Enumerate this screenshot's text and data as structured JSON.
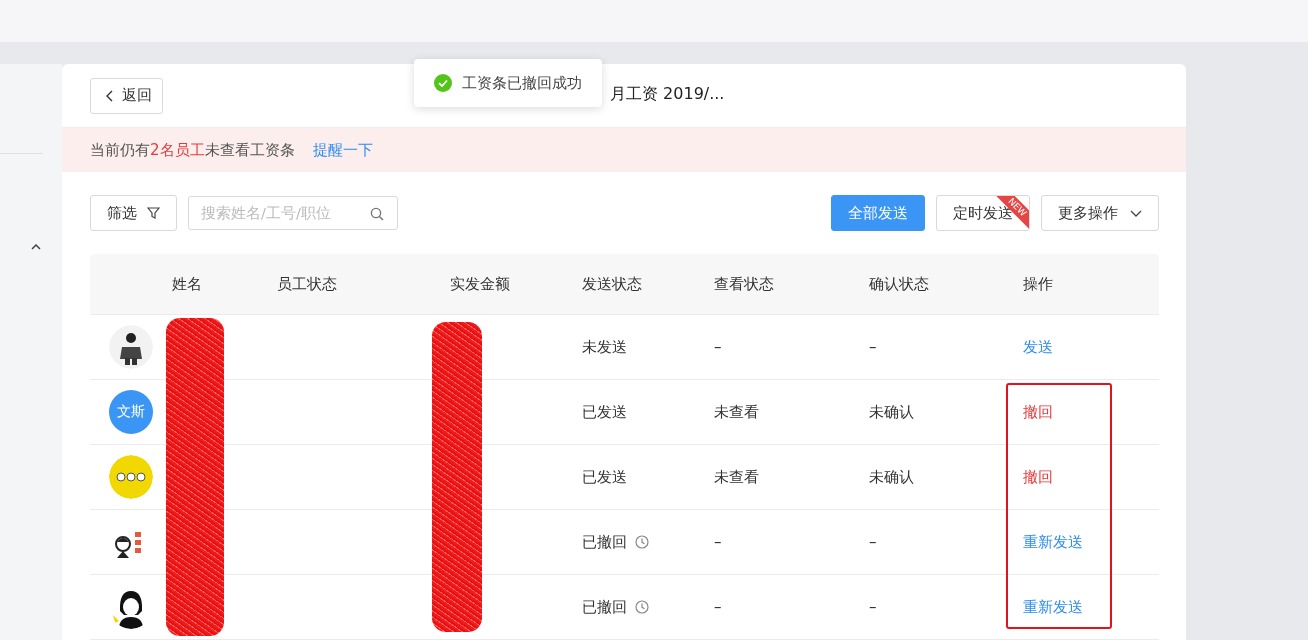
{
  "header": {
    "back_button": "返回",
    "title": "月工资 2019/..."
  },
  "toast": {
    "message": "工资条已撤回成功"
  },
  "alert": {
    "parts": [
      "当前仍有",
      "2名员工",
      "未查看工资条"
    ],
    "link": "提醒一下"
  },
  "toolbar": {
    "filter_button": "筛选",
    "search": {
      "placeholder": "搜索姓名/工号/职位"
    },
    "send_all_button": "全部发送",
    "schedule_button": "定时发送",
    "schedule_badge": "NEW",
    "more_button": "更多操作"
  },
  "table": {
    "columns": [
      "姓名",
      "员工状态",
      "实发金额",
      "发送状态",
      "查看状态",
      "确认状态",
      "操作"
    ],
    "rows": [
      {
        "send_status": "未发送",
        "recalled": false,
        "view_status": "–",
        "confirm_status": "–",
        "action": {
          "kind": "send",
          "label": "发送"
        }
      },
      {
        "avatar": {
          "kind": "text",
          "text": "文斯",
          "color": "#3a95f5"
        },
        "send_status": "已发送",
        "recalled": false,
        "view_status": "未查看",
        "confirm_status": "未确认",
        "action": {
          "kind": "revoke",
          "label": "撤回"
        }
      },
      {
        "send_status": "已发送",
        "recalled": false,
        "view_status": "未查看",
        "confirm_status": "未确认",
        "action": {
          "kind": "revoke",
          "label": "撤回"
        }
      },
      {
        "send_status": "已撤回",
        "recalled": true,
        "view_status": "–",
        "confirm_status": "–",
        "action": {
          "kind": "resend",
          "label": "重新发送"
        }
      },
      {
        "send_status": "已撤回",
        "recalled": true,
        "view_status": "–",
        "confirm_status": "–",
        "action": {
          "kind": "resend",
          "label": "重新发送"
        }
      }
    ]
  }
}
